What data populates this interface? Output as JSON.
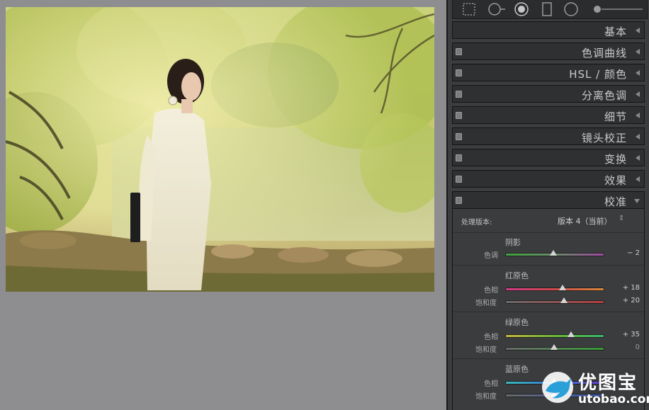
{
  "panel": {
    "sections": [
      {
        "label": "基本",
        "toggle": false
      },
      {
        "label": "色调曲线",
        "toggle": true
      },
      {
        "label": "HSL / 颜色",
        "toggle": true
      },
      {
        "label": "分离色调",
        "toggle": true
      },
      {
        "label": "细节",
        "toggle": true
      },
      {
        "label": "镜头校正",
        "toggle": true
      },
      {
        "label": "变换",
        "toggle": true
      },
      {
        "label": "效果",
        "toggle": true
      },
      {
        "label": "校准",
        "toggle": true
      }
    ],
    "calibration": {
      "process_label": "处理版本:",
      "process_value": "版本 4（当前）",
      "shadows": {
        "title": "阴影",
        "tint_label": "色调",
        "tint_value": "− 2"
      },
      "red": {
        "title": "红原色",
        "hue_label": "色相",
        "hue_value": "+ 18",
        "sat_label": "饱和度",
        "sat_value": "+ 20"
      },
      "green": {
        "title": "绿原色",
        "hue_label": "色相",
        "hue_value": "+ 35",
        "sat_label": "饱和度",
        "sat_value": "0"
      },
      "blue": {
        "title": "蓝原色",
        "hue_label": "色相",
        "sat_label": "饱和度"
      }
    }
  },
  "sliders": {
    "shadow_tint": -2,
    "red_hue": 18,
    "red_sat": 20,
    "green_hue": 35,
    "green_sat": 0,
    "blue_hue": 0,
    "blue_sat": 0
  },
  "watermark": {
    "brand": "优图宝",
    "url": "utobao.com"
  },
  "colors": {
    "panel_bg": "#3b3d3f",
    "section_bg": "#2e3032",
    "canvas_bg": "#8e8e90",
    "accent_blue": "#2a9fd8"
  }
}
